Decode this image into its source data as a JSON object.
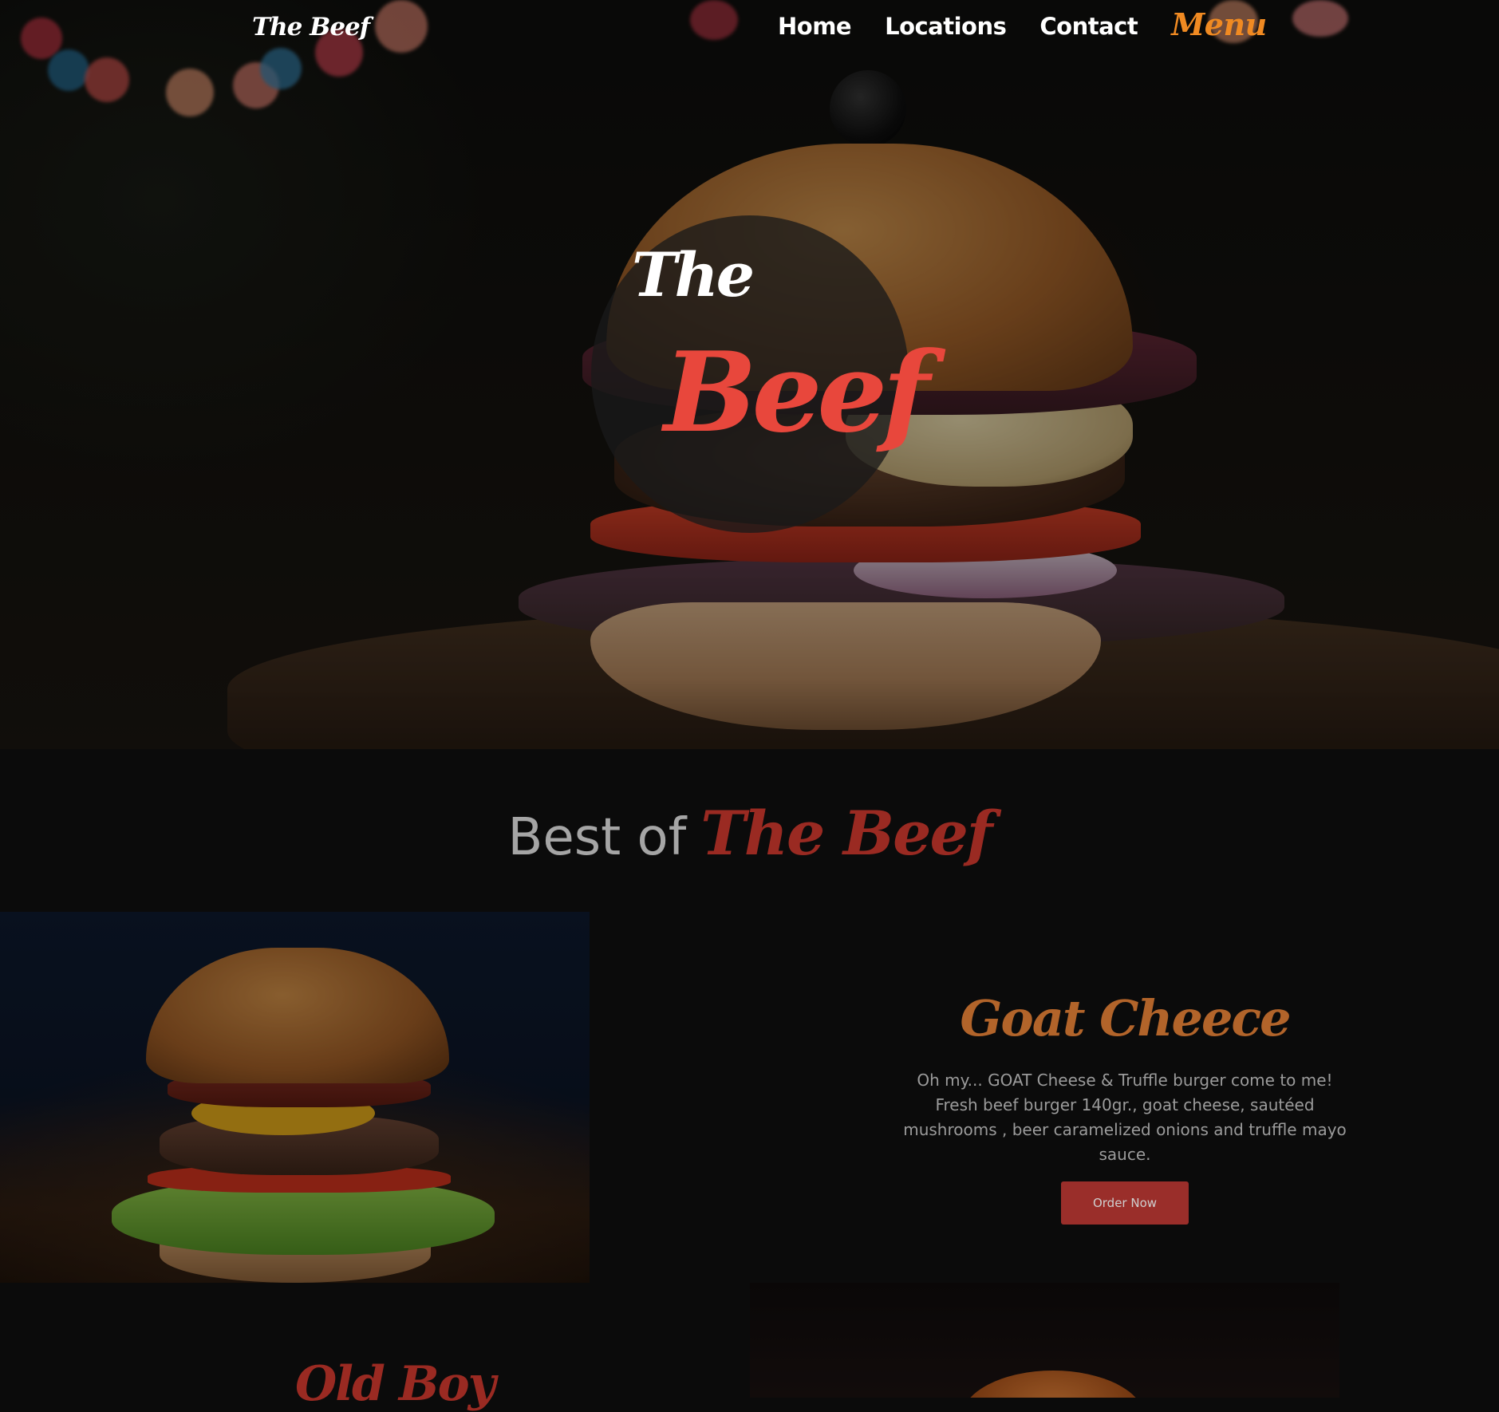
{
  "header": {
    "logo": "The Beef",
    "nav": [
      {
        "label": "Home"
      },
      {
        "label": "Locations"
      },
      {
        "label": "Contact"
      },
      {
        "label": "Menu",
        "active": true
      }
    ]
  },
  "hero": {
    "badge_line1": "The",
    "badge_line2": "Beef"
  },
  "best_of": {
    "lead": "Best of",
    "brand": "The Beef"
  },
  "items": [
    {
      "title": "Goat Cheece",
      "description": "Oh my... GOAT Cheese & Truffle burger come to me! Fresh beef burger 140gr., goat cheese, sautéed mushrooms , beer caramelized onions and truffle mayo sauce.",
      "button": "Order Now"
    },
    {
      "title": "Old Boy"
    }
  ],
  "colors": {
    "accent_orange": "#f08a22",
    "brand_red": "#e8473c",
    "dark_red": "#9a2a22",
    "item_title_brown": "#b2642a",
    "button_red": "#9a2e2a",
    "background": "#0b0b0b"
  }
}
